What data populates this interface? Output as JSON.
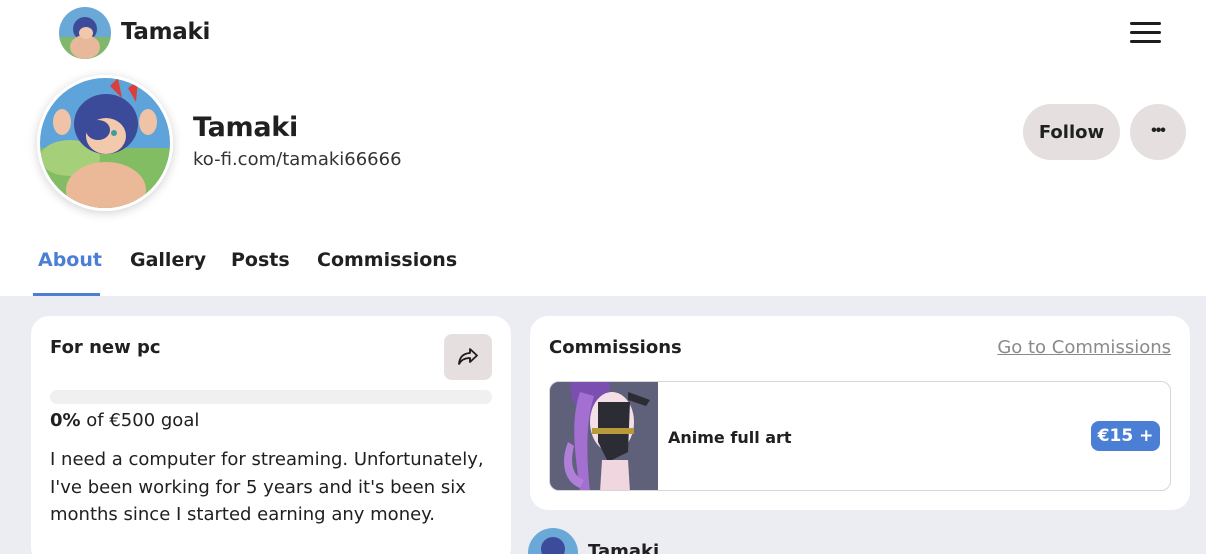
{
  "topbar": {
    "name": "Tamaki",
    "menu_icon": "hamburger-menu-icon"
  },
  "profile": {
    "name": "Tamaki",
    "url": "ko-fi.com/tamaki66666",
    "follow_label": "Follow",
    "more_icon": "more-dots-icon",
    "more_label": "•••"
  },
  "tabs": [
    {
      "label": "About",
      "active": true
    },
    {
      "label": "Gallery",
      "active": false
    },
    {
      "label": "Posts",
      "active": false
    },
    {
      "label": "Commissions",
      "active": false
    }
  ],
  "goal": {
    "title": "For new pc",
    "share_icon": "share-arrow-icon",
    "progress_fraction": 0,
    "percent_text": "0%",
    "goal_text": " of €500 goal",
    "description": "I need a computer for streaming. Unfortunately, I've been working for 5 years and it's been six months since I started earning any money."
  },
  "commissions": {
    "title": "Commissions",
    "link_label": "Go to Commissions",
    "items": [
      {
        "name": "Anime full art",
        "price": "€15 +"
      }
    ]
  },
  "post": {
    "author": "Tamaki"
  },
  "colors": {
    "accent": "#4b7fd6",
    "button_bg": "#e5dfdf",
    "page_bg": "#ecedf2"
  }
}
